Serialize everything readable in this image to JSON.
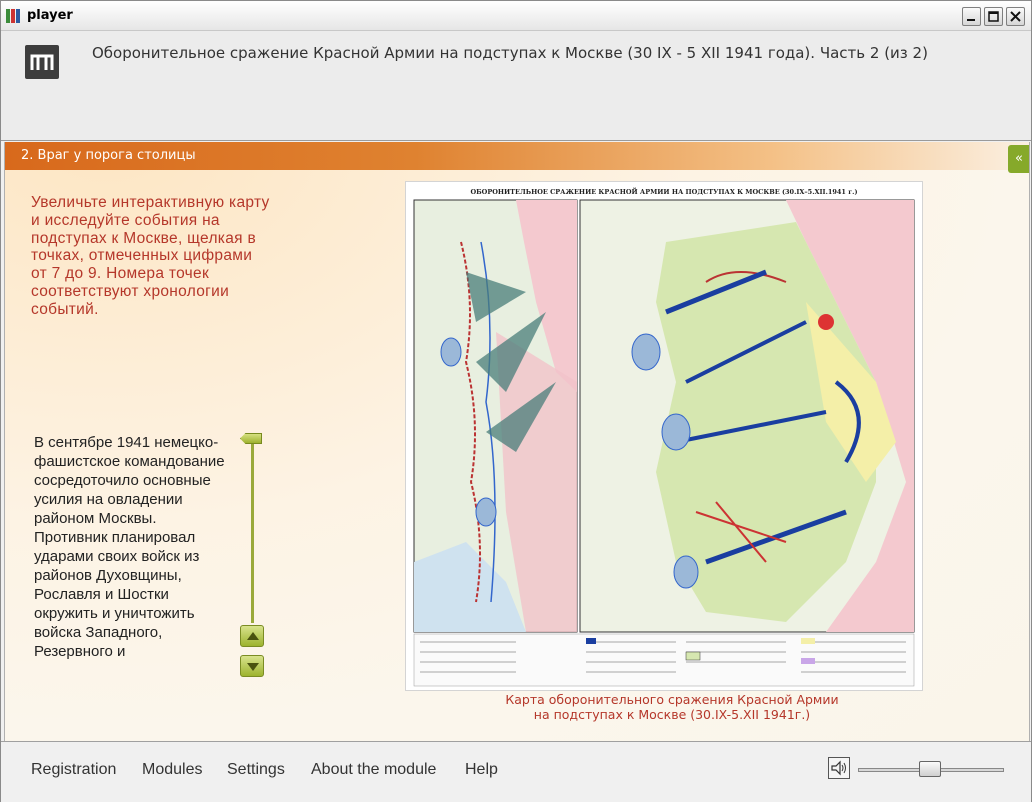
{
  "window": {
    "title": "player"
  },
  "header": {
    "title": "Оборонительное сражение Красной Армии на подступах к Москве (30 IX - 5 XII 1941 года). Часть 2 (из 2)"
  },
  "section": {
    "title": "2. Враг у порога столицы",
    "collapse_label": "«"
  },
  "instructions": "Увеличьте интерактивную карту и исследуйте события на подступах к Москве, щелкая в точках, отмеченных цифрами от 7 до 9. Номера точек соответствуют хронологии событий.",
  "narrative": "В сентябре 1941 немецко-фашистское командование сосредоточило основные усилия на овладении районом Москвы. Противник планировал ударами своих войск из районов Духовщины, Рославля и Шостки окружить и уничтожить войска Западного, Резервного и",
  "map": {
    "heading": "ОБОРОНИТЕЛЬНОЕ СРАЖЕНИЕ КРАСНОЙ АРМИИ НА ПОДСТУПАХ К МОСКВЕ (30.IX–5.XII.1941 г.)",
    "caption_line1": "Карта оборонительного сражения Красной Армии",
    "caption_line2": "на подступах к Москве (30.IX-5.XII 1941г.)"
  },
  "footer": {
    "menu": [
      "Registration",
      "Modules",
      "Settings",
      "About the module",
      "Help"
    ],
    "volume": 0.5
  },
  "colors": {
    "accent_orange": "#d8691c",
    "text_red": "#b5372a",
    "control_green": "#9db32f"
  }
}
